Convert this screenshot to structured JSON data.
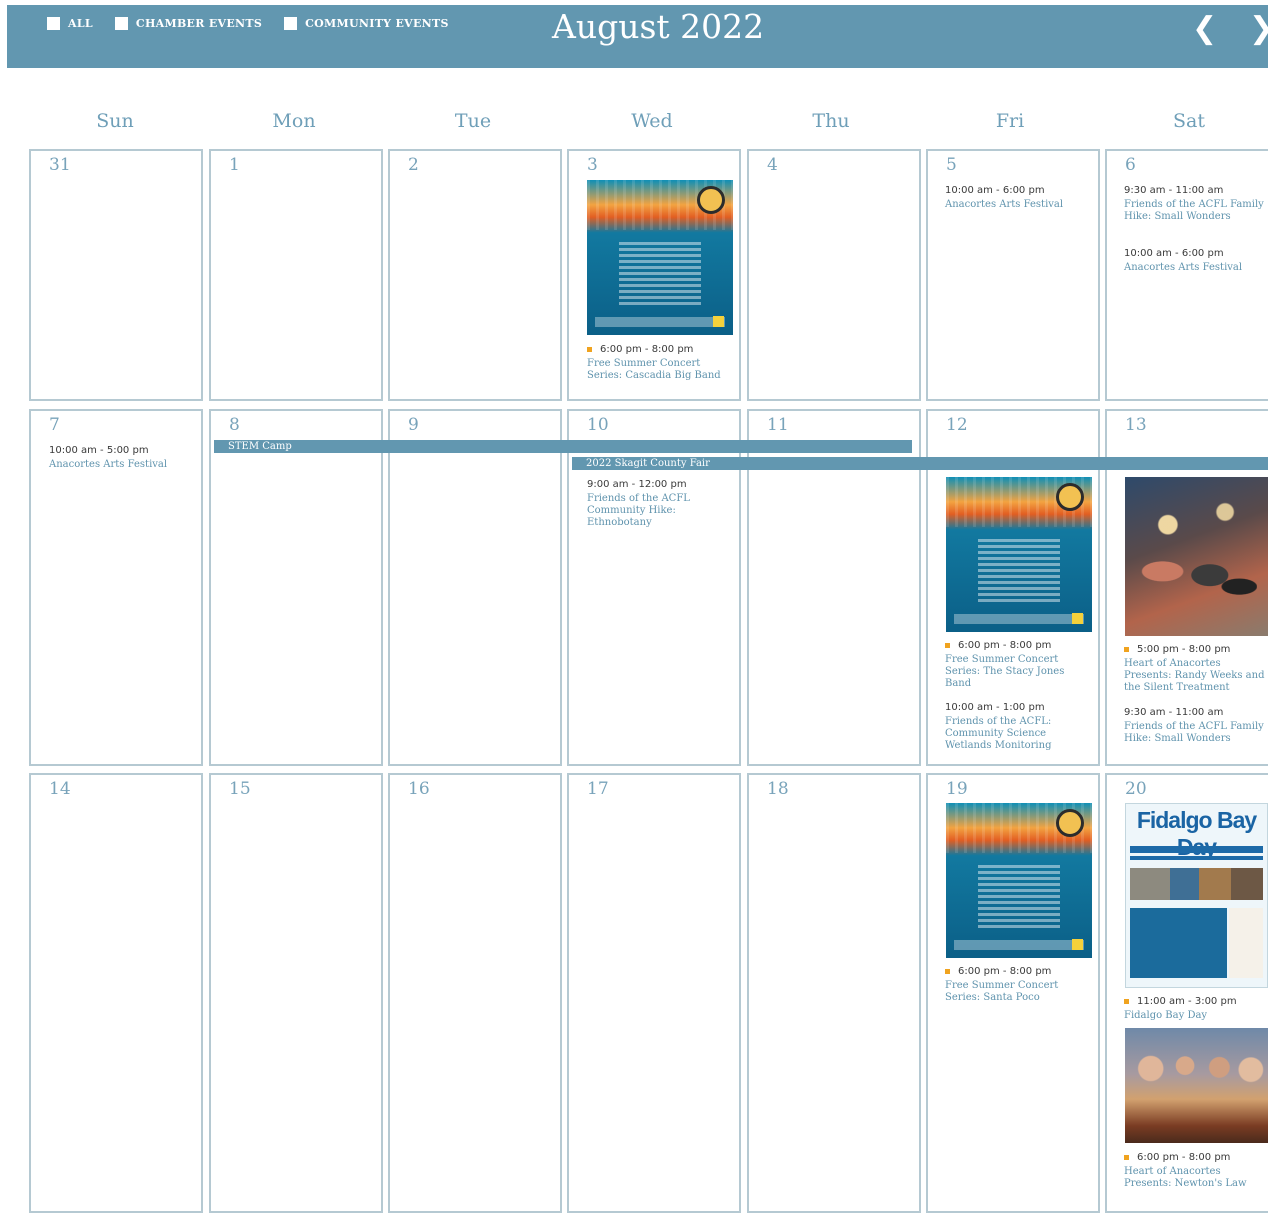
{
  "filters": [
    {
      "label": "ALL"
    },
    {
      "label": "CHAMBER EVENTS"
    },
    {
      "label": "COMMUNITY EVENTS"
    }
  ],
  "header": {
    "title": "August 2022",
    "prev_icon": "chevron-left-icon",
    "next_icon": "chevron-right-icon"
  },
  "weekdays": [
    "Sun",
    "Mon",
    "Tue",
    "Wed",
    "Thu",
    "Fri",
    "Sat"
  ],
  "days": {
    "r1": [
      "31",
      "1",
      "2",
      "3",
      "4",
      "5",
      "6"
    ],
    "r2": [
      "7",
      "8",
      "9",
      "10",
      "11",
      "12",
      "13"
    ],
    "r3": [
      "14",
      "15",
      "16",
      "17",
      "18",
      "19",
      "20"
    ]
  },
  "bars": {
    "stem": "STEM Camp",
    "fair": "2022 Skagit County Fair"
  },
  "events": {
    "d3_1": {
      "time": "6:00 pm - 8:00 pm",
      "title": "Free Summer Concert Series: Cascadia Big Band"
    },
    "d5_1": {
      "time": "10:00 am - 6:00 pm",
      "title": "Anacortes Arts Festival"
    },
    "d6_1": {
      "time": "9:30 am - 11:00 am",
      "title": "Friends of the ACFL Family Hike: Small Wonders"
    },
    "d6_2": {
      "time": "10:00 am - 6:00 pm",
      "title": "Anacortes Arts Festival"
    },
    "d7_1": {
      "time": "10:00 am - 5:00 pm",
      "title": "Anacortes Arts Festival"
    },
    "d10_1": {
      "time": "9:00 am - 12:00 pm",
      "title": "Friends of the ACFL Community Hike: Ethnobotany"
    },
    "d12_1": {
      "time": "6:00 pm - 8:00 pm",
      "title": "Free Summer Concert Series: The Stacy Jones Band"
    },
    "d12_2": {
      "time": "10:00 am - 1:00 pm",
      "title": "Friends of the ACFL: Community Science Wetlands Monitoring"
    },
    "d13_1": {
      "time": "5:00 pm - 8:00 pm",
      "title": "Heart of Anacortes Presents: Randy Weeks and the Silent Treatment"
    },
    "d13_2": {
      "time": "9:30 am - 11:00 am",
      "title": "Friends of the ACFL Family Hike: Small Wonders"
    },
    "d19_1": {
      "time": "6:00 pm - 8:00 pm",
      "title": "Free Summer Concert Series: Santa Poco"
    },
    "d20_1": {
      "time": "11:00 am - 3:00 pm",
      "title": "Fidalgo Bay Day"
    },
    "d20_2": {
      "time": "6:00 pm - 8:00 pm",
      "title": "Heart of Anacortes Presents: Newton's Law"
    }
  },
  "flyer": {
    "title": "Fidalgo Bay Day"
  },
  "colors": {
    "accent": "#6297b0",
    "event_marker": "#f0a31f",
    "text_link": "#5f93ad"
  }
}
